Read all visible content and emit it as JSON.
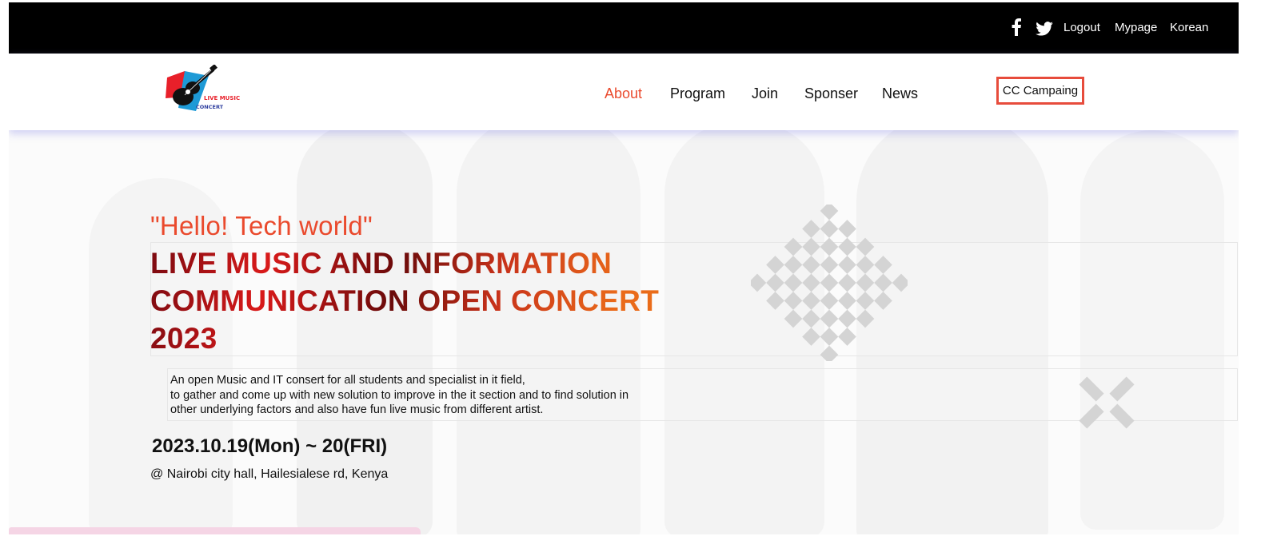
{
  "topbar": {
    "facebook_icon": "facebook-icon",
    "twitter_icon": "twitter-icon",
    "logout_label": "Logout",
    "mypage_label": "Mypage",
    "language_label": "Korean"
  },
  "header": {
    "logo": {
      "line1": "LIVE MUSIC",
      "line2": "CONCERT"
    },
    "nav": [
      "About",
      "Program",
      "Join",
      "Sponser",
      "News"
    ],
    "active_nav": "About",
    "cta_label": "CC Campaing"
  },
  "hero": {
    "tagline": "\"Hello! Tech world\"",
    "headline_line1": "LIVE MUSIC AND INFORMATION",
    "headline_line2": "COMMUNICATION OPEN CONCERT",
    "headline_line3": "2023",
    "description_line1": "An open Music and IT consert for all students and specialist in it field,",
    "description_line2": "to gather and come up with new solution to improve in the it section and to find solution in",
    "description_line3": "other underlying factors and also have fun live music from different artist.",
    "dates": "2023.10.19(Mon) ~ 20(FRI)",
    "venue": "@ Nairobi city hall, Hailesialese rd, Kenya"
  },
  "colors": {
    "accent": "#ea4a2d",
    "topbar_bg": "#000000",
    "cta_border": "#e74c3c"
  }
}
